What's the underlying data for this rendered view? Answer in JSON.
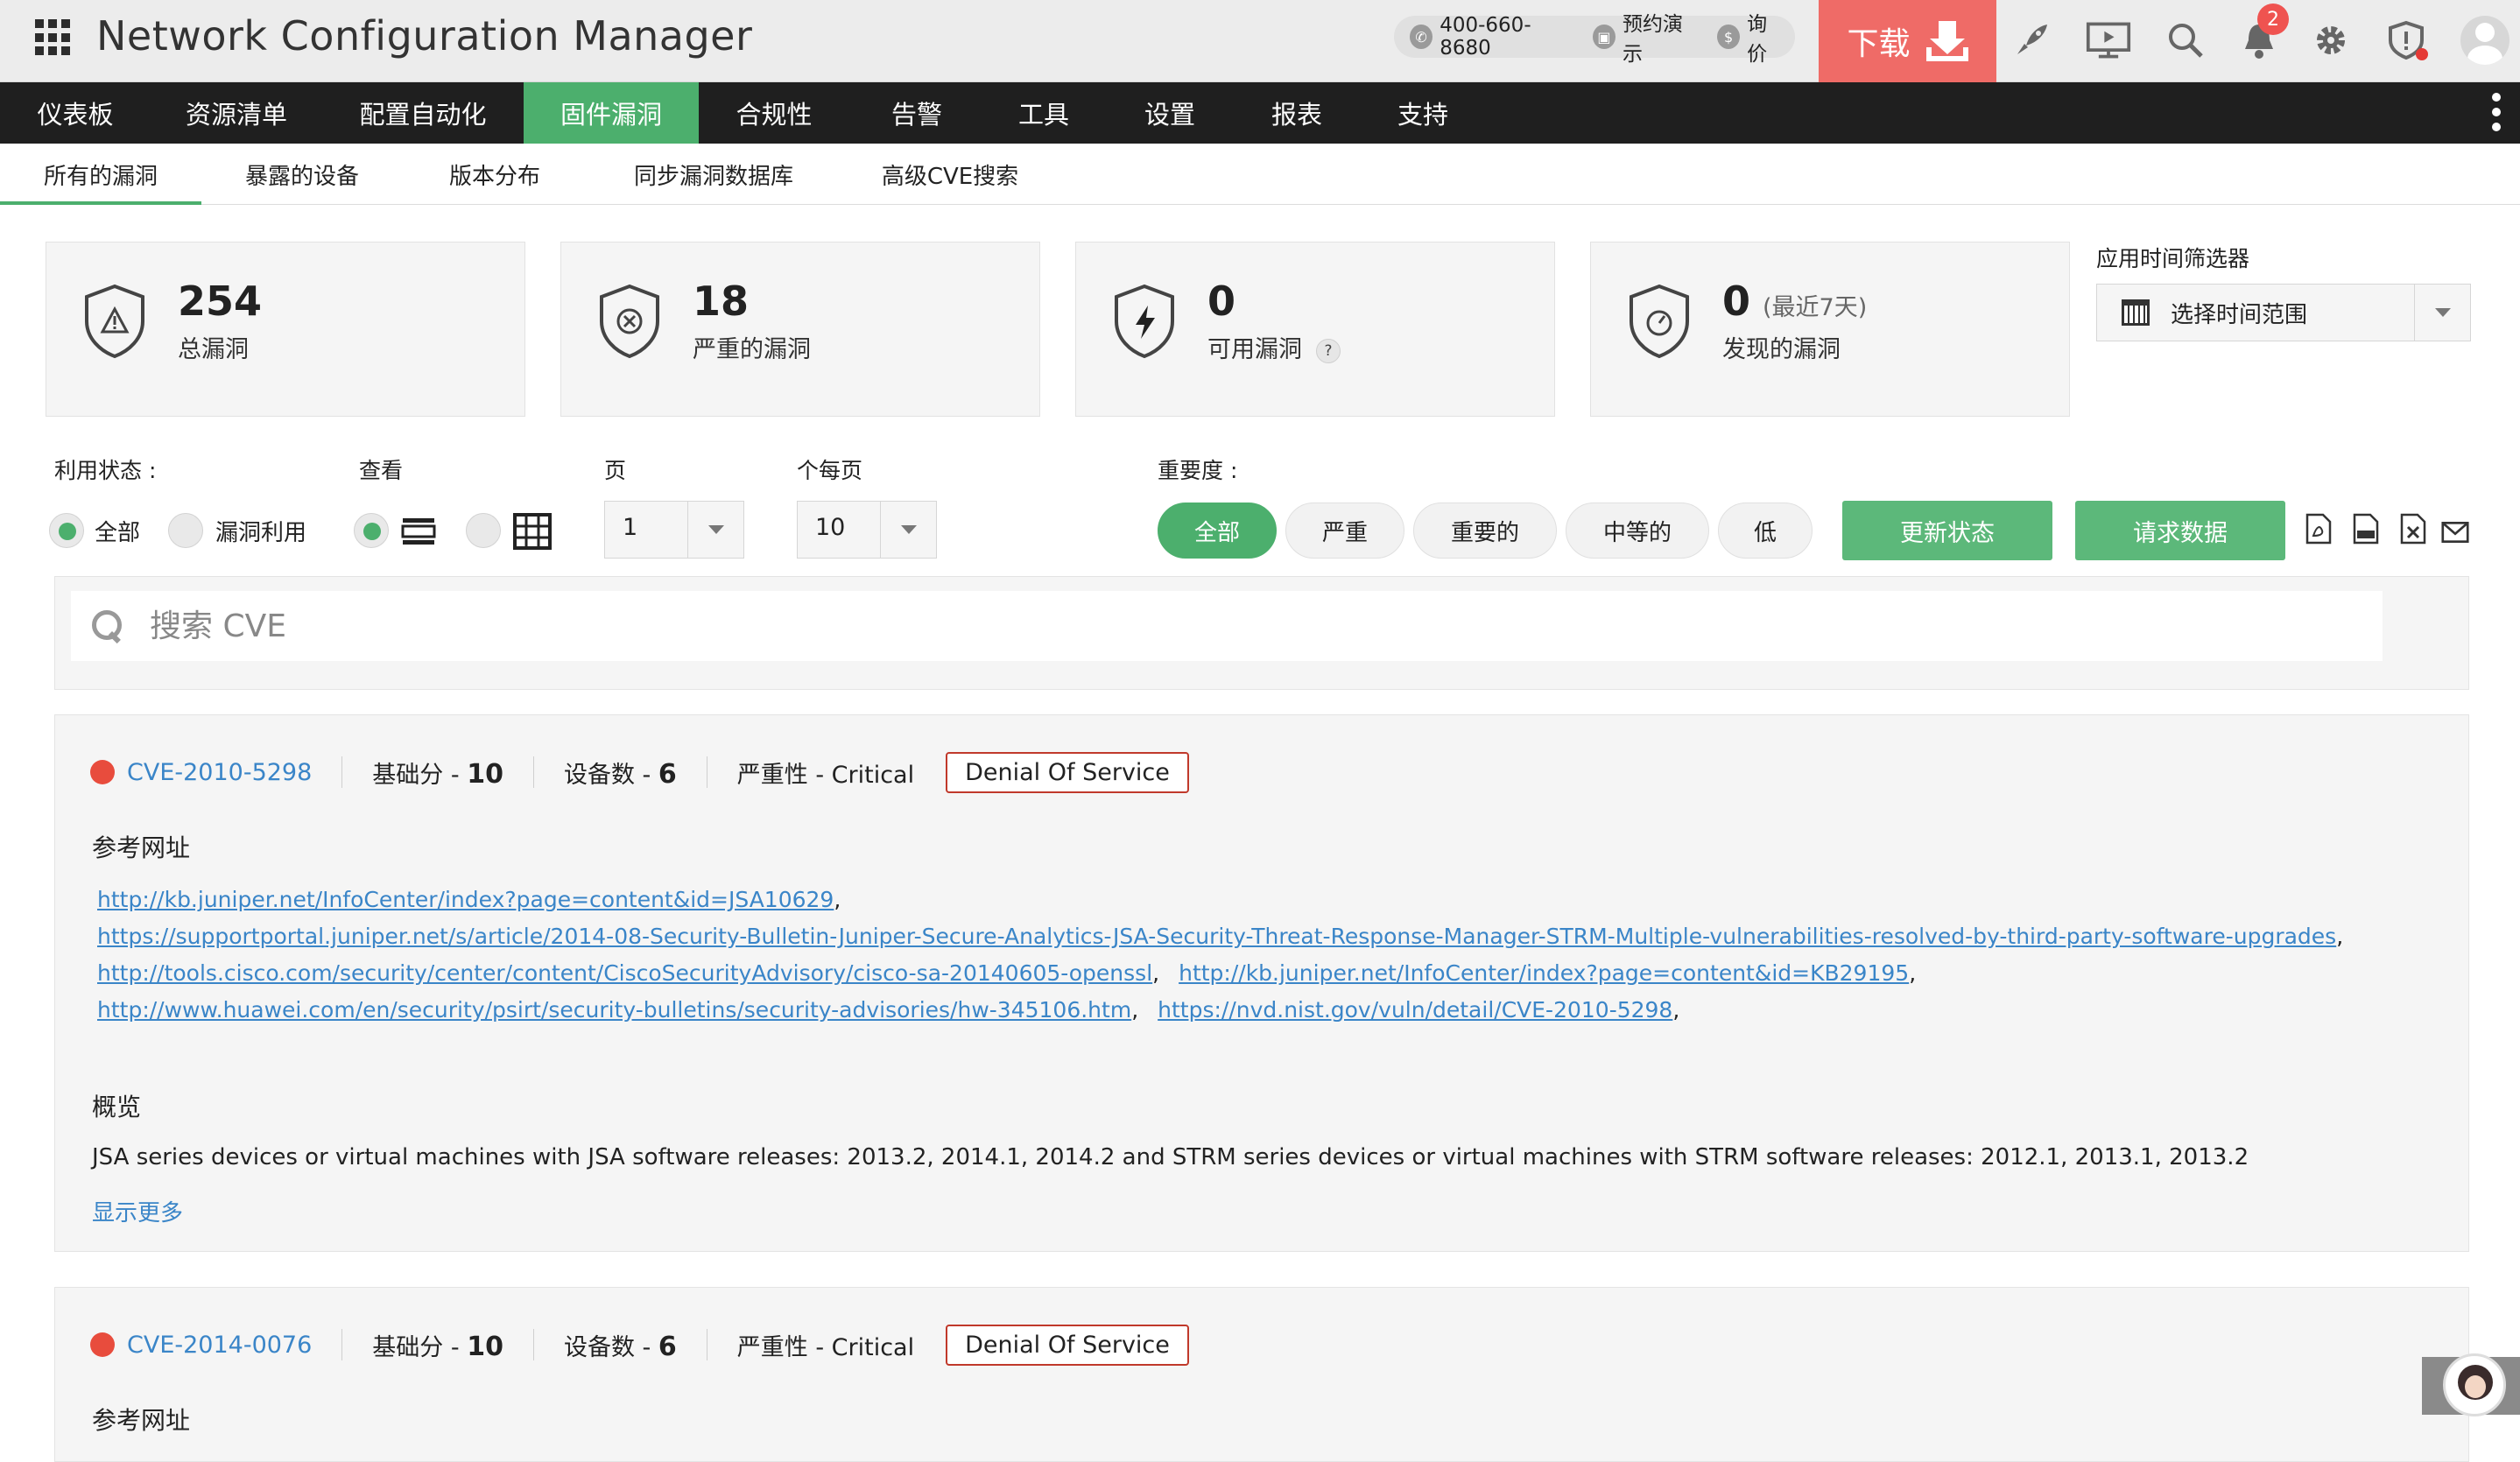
{
  "app": {
    "title": "Network Configuration Manager",
    "phone": "400-660-8680",
    "demo": "预约演示",
    "price": "询价",
    "download": "下载",
    "notification_count": "2",
    "accent_color": "#4caf6d",
    "download_color": "#ef6b67"
  },
  "main_nav": [
    "仪表板",
    "资源清单",
    "配置自动化",
    "固件漏洞",
    "合规性",
    "告警",
    "工具",
    "设置",
    "报表",
    "支持"
  ],
  "sub_nav": [
    "所有的漏洞",
    "暴露的设备",
    "版本分布",
    "同步漏洞数据库",
    "高级CVE搜索"
  ],
  "stats": [
    {
      "value": "254",
      "label": "总漏洞",
      "icon": "shield-warning-icon"
    },
    {
      "value": "18",
      "label": "严重的漏洞",
      "icon": "shield-x-icon"
    },
    {
      "value": "0",
      "label": "可用漏洞",
      "icon": "shield-bolt-icon",
      "help": "?"
    },
    {
      "value": "0",
      "label": "发现的漏洞",
      "extra": "(最近7天)",
      "icon": "shield-gauge-icon"
    }
  ],
  "time_filter": {
    "label": "应用时间筛选器",
    "value": "选择时间范围"
  },
  "filters": {
    "exploit_label": "利用状态 :",
    "exploit_all": "全部",
    "exploit_used": "漏洞利用",
    "view_label": "查看",
    "page_label": "页",
    "page_value": "1",
    "per_page_label": "个每页",
    "per_page_value": "10",
    "severity_label": "重要度 :",
    "severity": [
      "全部",
      "严重",
      "重要的",
      "中等的",
      "低"
    ],
    "update_btn": "更新状态",
    "request_btn": "请求数据"
  },
  "search": {
    "placeholder": "搜索 CVE"
  },
  "cves": [
    {
      "id": "CVE-2010-5298",
      "base_label": "基础分 - ",
      "base": "10",
      "devices_label": "设备数 - ",
      "devices": "6",
      "severity": "严重性 - Critical",
      "tag": "Denial Of Service",
      "refs_title": "参考网址",
      "refs": [
        "http://kb.juniper.net/InfoCenter/index?page=content&id=JSA10629",
        "https://supportportal.juniper.net/s/article/2014-08-Security-Bulletin-Juniper-Secure-Analytics-JSA-Security-Threat-Response-Manager-STRM-Multiple-vulnerabilities-resolved-by-third-party-software-upgrades",
        "http://tools.cisco.com/security/center/content/CiscoSecurityAdvisory/cisco-sa-20140605-openssl",
        "http://kb.juniper.net/InfoCenter/index?page=content&id=KB29195",
        "http://www.huawei.com/en/security/psirt/security-bulletins/security-advisories/hw-345106.htm",
        "https://nvd.nist.gov/vuln/detail/CVE-2010-5298"
      ],
      "overview_title": "概览",
      "overview": "JSA series devices or virtual machines with JSA software releases: 2013.2, 2014.1, 2014.2 and STRM series devices or virtual machines with STRM software releases: 2012.1, 2013.1, 2013.2",
      "show_more": "显示更多"
    },
    {
      "id": "CVE-2014-0076",
      "base_label": "基础分 - ",
      "base": "10",
      "devices_label": "设备数 - ",
      "devices": "6",
      "severity": "严重性 - Critical",
      "tag": "Denial Of Service",
      "refs_title": "参考网址"
    }
  ]
}
